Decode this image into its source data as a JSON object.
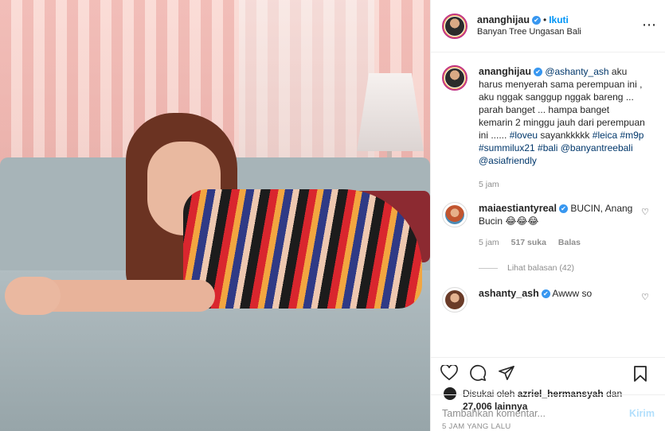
{
  "header": {
    "username": "ananghijau",
    "verified_mark": "✔",
    "separator": "•",
    "follow_label": "Ikuti",
    "location": "Banyan Tree Ungasan Bali",
    "more_icon": "⋯"
  },
  "caption": {
    "username": "ananghijau",
    "mention": "@ashanty_ash",
    "text": " aku harus menyerah sama perempuan ini , aku nggak sanggup nggak bareng ... parah banget ... hampa banget kemarin 2 minggu jauh dari perempuan ini ...... ",
    "tags": "#loveu",
    "text2": " sayankkkkk ",
    "tags2": "#leica #m9p #summilux21 #bali @banyantreebali @asiafriendly",
    "time": "5 jam"
  },
  "comments": [
    {
      "username": "maiaestiantyreal",
      "text": " BUCIN, Anang Bucin 😂😂😂",
      "time": "5 jam",
      "likes": "517 suka",
      "reply": "Balas",
      "view_replies": "Lihat balasan (42)"
    },
    {
      "username": "ashanty_ash",
      "text": " Awww so"
    }
  ],
  "likes": {
    "prefix": "Disukai oleh ",
    "user": "azriel_hermansyah",
    "middle": " dan",
    "count": "27,006 lainnya"
  },
  "timestamp": "5 JAM YANG LALU",
  "add_comment": {
    "placeholder": "Tambahkan komentar...",
    "send_label": "Kirim"
  },
  "colors": {
    "accent": "#0095f6",
    "link": "#00376b",
    "muted": "#8e8e8e",
    "verified": "#3897f0"
  }
}
